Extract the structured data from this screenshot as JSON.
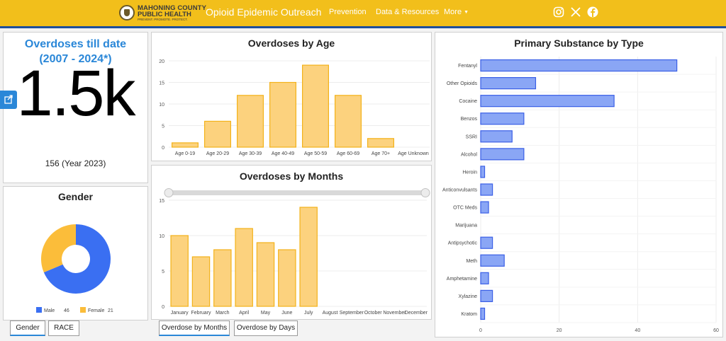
{
  "header": {
    "logo_line1": "MAHONING COUNTY",
    "logo_line2": "PUBLIC HEALTH",
    "logo_line3": "PREVENT. PROMOTE. PROTECT.",
    "title": "Opioid Epidemic Outreach",
    "nav": [
      "Prevention",
      "Data & Resources",
      "More"
    ],
    "social_icons": [
      "instagram-icon",
      "x-icon",
      "facebook-icon"
    ],
    "accent": "#f2bf1b"
  },
  "kpi": {
    "title": "Overdoses till date (2007 - 2024*)",
    "value": "1.5k",
    "subtitle": "156 (Year 2023)"
  },
  "gender_tabs": [
    "Gender",
    "RACE"
  ],
  "months_tabs": [
    "Overdose by Months",
    "Overdose by Days"
  ],
  "chart_data": [
    {
      "type": "bar",
      "title": "Overdoses by Age",
      "categories": [
        "Age 0-19",
        "Age 20-29",
        "Age 30-39",
        "Age 40-49",
        "Age 50-59",
        "Age 60-69",
        "Age 70+",
        "Age Unknown"
      ],
      "values": [
        1,
        6,
        12,
        15,
        19,
        12,
        2,
        0
      ],
      "ylim": [
        0,
        20
      ],
      "yticks": [
        0,
        5,
        10,
        15,
        20
      ],
      "color": "#fcd27e",
      "grid": true
    },
    {
      "type": "bar",
      "title": "Overdoses by Months",
      "categories": [
        "January",
        "February",
        "March",
        "April",
        "May",
        "June",
        "July",
        "August",
        "September",
        "October",
        "November",
        "December"
      ],
      "values": [
        10,
        7,
        8,
        11,
        9,
        8,
        14,
        0,
        0,
        0,
        0,
        0
      ],
      "ylim": [
        0,
        15
      ],
      "yticks": [
        0,
        5,
        10,
        15
      ],
      "color": "#fcd27e",
      "grid": true
    },
    {
      "type": "bar",
      "orientation": "horizontal",
      "title": "Primary Substance by Type",
      "categories": [
        "Fentanyl",
        "Other Opioids",
        "Cocaine",
        "Benzos",
        "SSRI",
        "Alcohol",
        "Heroin",
        "Anticonvulsants",
        "OTC Meds",
        "Marijuana",
        "Antipsychotic",
        "Meth",
        "Amphetamine",
        "Xylazine",
        "Kratom"
      ],
      "values": [
        50,
        14,
        34,
        11,
        8,
        11,
        1,
        3,
        2,
        0,
        3,
        6,
        2,
        3,
        1
      ],
      "xlim": [
        0,
        60
      ],
      "xticks": [
        0,
        20,
        40,
        60
      ],
      "color": "#8aa6f5",
      "grid": true
    },
    {
      "type": "pie",
      "title": "Gender",
      "labels": [
        "Male",
        "Female"
      ],
      "values": [
        46,
        21
      ],
      "colors": [
        "#3a6ff2",
        "#fbbd3a"
      ],
      "legend": "bottom"
    }
  ]
}
